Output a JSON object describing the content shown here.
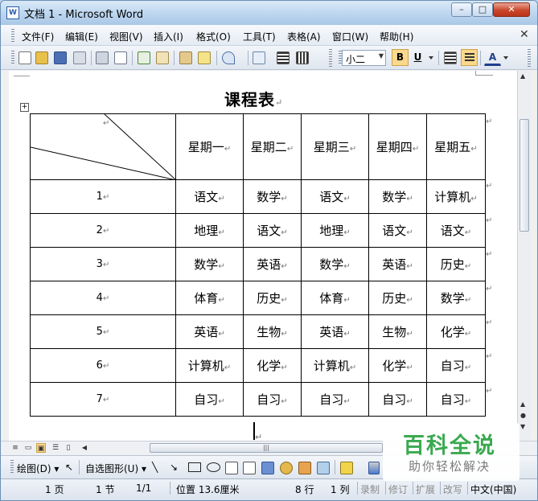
{
  "window": {
    "title": "文档 1 - Microsoft Word",
    "icon_label": "W",
    "buttons": {
      "minimize": "–",
      "maximize": "□",
      "close": "✕"
    }
  },
  "menu": {
    "items": [
      "文件(F)",
      "编辑(E)",
      "视图(V)",
      "插入(I)",
      "格式(O)",
      "工具(T)",
      "表格(A)",
      "窗口(W)",
      "帮助(H)"
    ],
    "close_glyph": "✕"
  },
  "toolbar": {
    "font_size": "小二",
    "bold_label": "B",
    "underline_label": "U",
    "font_color_label": "A"
  },
  "document": {
    "title": "课程表",
    "paragraph_mark": "↵",
    "table": {
      "header": [
        "星期一",
        "星期二",
        "星期三",
        "星期四",
        "星期五"
      ],
      "rows": [
        {
          "num": "1",
          "cells": [
            "语文",
            "数学",
            "语文",
            "数学",
            "计算机"
          ]
        },
        {
          "num": "2",
          "cells": [
            "地理",
            "语文",
            "地理",
            "语文",
            "语文"
          ]
        },
        {
          "num": "3",
          "cells": [
            "数学",
            "英语",
            "数学",
            "英语",
            "历史"
          ]
        },
        {
          "num": "4",
          "cells": [
            "体育",
            "历史",
            "体育",
            "历史",
            "数学"
          ]
        },
        {
          "num": "5",
          "cells": [
            "英语",
            "生物",
            "英语",
            "生物",
            "化学"
          ]
        },
        {
          "num": "6",
          "cells": [
            "计算机",
            "化学",
            "计算机",
            "化学",
            "自习"
          ]
        },
        {
          "num": "7",
          "cells": [
            "自习",
            "自习",
            "自习",
            "自习",
            "自习"
          ]
        }
      ]
    }
  },
  "drawing_toolbar": {
    "draw_label": "绘图(D)",
    "autoshapes_label": "自选图形(U)"
  },
  "status": {
    "page": "1 页",
    "section": "1 节",
    "page_of": "1/1",
    "position": "位置 13.6厘米",
    "line": "8 行",
    "column": "1 列",
    "rec": "录制",
    "trk": "修订",
    "ext": "扩展",
    "ovr": "改写",
    "language": "中文(中国)"
  },
  "watermark": {
    "brand": "百科全说",
    "slogan": "助你轻松解决"
  },
  "colors": {
    "accent_active": "#fbd88b",
    "watermark_green": "#3aa94f",
    "close_red": "#c9472c"
  }
}
